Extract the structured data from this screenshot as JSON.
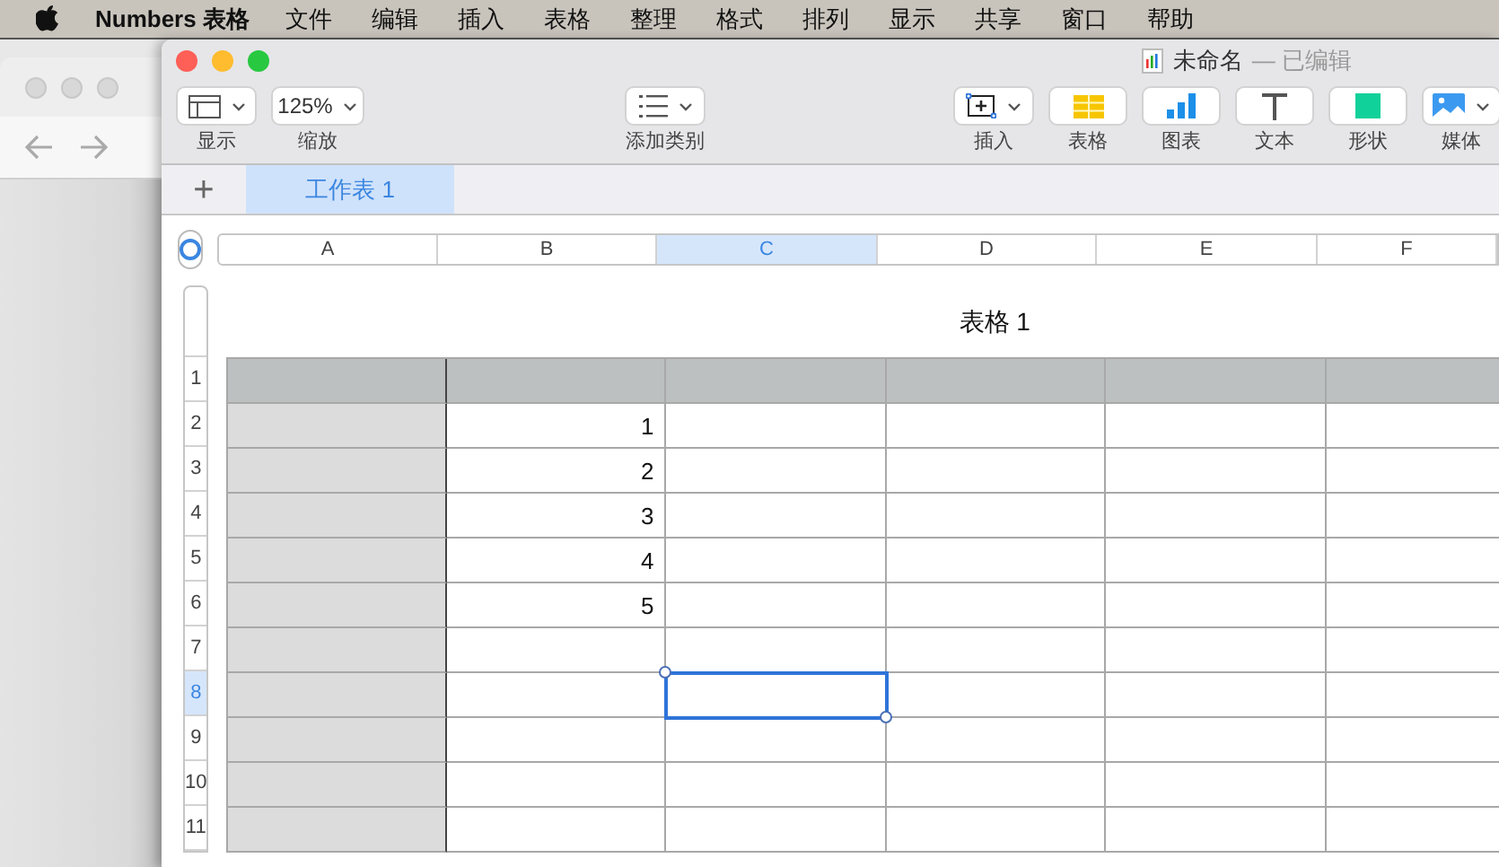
{
  "menu_bar": {
    "app": "Numbers 表格",
    "items": [
      "文件",
      "编辑",
      "插入",
      "表格",
      "整理",
      "格式",
      "排列",
      "显示",
      "共享",
      "窗口",
      "帮助"
    ]
  },
  "window": {
    "title": "未命名",
    "subtitle": "— 已编辑"
  },
  "toolbar": {
    "left": [
      {
        "kind": "view",
        "label": "显示"
      },
      {
        "kind": "zoom",
        "label": "缩放",
        "value": "125%"
      }
    ],
    "center": [
      {
        "kind": "category",
        "label": "添加类别"
      }
    ],
    "right": [
      {
        "kind": "insert",
        "label": "插入"
      },
      {
        "kind": "table",
        "label": "表格"
      },
      {
        "kind": "chart",
        "label": "图表"
      },
      {
        "kind": "text",
        "label": "文本"
      },
      {
        "kind": "shape",
        "label": "形状"
      },
      {
        "kind": "media",
        "label": "媒体"
      }
    ]
  },
  "sheet_tabs": {
    "add": "+",
    "tabs": [
      {
        "label": "工作表 1",
        "selected": true
      }
    ]
  },
  "table": {
    "title": "表格 1",
    "columns": [
      {
        "label": "A",
        "selected": false
      },
      {
        "label": "B",
        "selected": false
      },
      {
        "label": "C",
        "selected": true
      },
      {
        "label": "D",
        "selected": false
      },
      {
        "label": "E",
        "selected": false
      },
      {
        "label": "F",
        "selected": false
      }
    ],
    "rows": [
      {
        "label": "1",
        "selected": false,
        "cells": [
          {
            "text": "",
            "selected": false
          },
          {
            "text": "",
            "selected": false
          },
          {
            "text": "",
            "selected": false
          },
          {
            "text": "",
            "selected": false
          },
          {
            "text": "",
            "selected": false
          },
          {
            "text": "",
            "selected": false
          }
        ]
      },
      {
        "label": "2",
        "selected": false,
        "cells": [
          {
            "text": "",
            "selected": false
          },
          {
            "text": "1",
            "selected": false
          },
          {
            "text": "",
            "selected": false
          },
          {
            "text": "",
            "selected": false
          },
          {
            "text": "",
            "selected": false
          },
          {
            "text": "",
            "selected": false
          }
        ]
      },
      {
        "label": "3",
        "selected": false,
        "cells": [
          {
            "text": "",
            "selected": false
          },
          {
            "text": "2",
            "selected": false
          },
          {
            "text": "",
            "selected": false
          },
          {
            "text": "",
            "selected": false
          },
          {
            "text": "",
            "selected": false
          },
          {
            "text": "",
            "selected": false
          }
        ]
      },
      {
        "label": "4",
        "selected": false,
        "cells": [
          {
            "text": "",
            "selected": false
          },
          {
            "text": "3",
            "selected": false
          },
          {
            "text": "",
            "selected": false
          },
          {
            "text": "",
            "selected": false
          },
          {
            "text": "",
            "selected": false
          },
          {
            "text": "",
            "selected": false
          }
        ]
      },
      {
        "label": "5",
        "selected": false,
        "cells": [
          {
            "text": "",
            "selected": false
          },
          {
            "text": "4",
            "selected": false
          },
          {
            "text": "",
            "selected": false
          },
          {
            "text": "",
            "selected": false
          },
          {
            "text": "",
            "selected": false
          },
          {
            "text": "",
            "selected": false
          }
        ]
      },
      {
        "label": "6",
        "selected": false,
        "cells": [
          {
            "text": "",
            "selected": false
          },
          {
            "text": "5",
            "selected": false
          },
          {
            "text": "",
            "selected": false
          },
          {
            "text": "",
            "selected": false
          },
          {
            "text": "",
            "selected": false
          },
          {
            "text": "",
            "selected": false
          }
        ]
      },
      {
        "label": "7",
        "selected": false,
        "cells": [
          {
            "text": "",
            "selected": false
          },
          {
            "text": "",
            "selected": false
          },
          {
            "text": "",
            "selected": false
          },
          {
            "text": "",
            "selected": false
          },
          {
            "text": "",
            "selected": false
          },
          {
            "text": "",
            "selected": false
          }
        ]
      },
      {
        "label": "8",
        "selected": true,
        "cells": [
          {
            "text": "",
            "selected": false
          },
          {
            "text": "",
            "selected": false
          },
          {
            "text": "",
            "selected": true
          },
          {
            "text": "",
            "selected": false
          },
          {
            "text": "",
            "selected": false
          },
          {
            "text": "",
            "selected": false
          }
        ]
      },
      {
        "label": "9",
        "selected": false,
        "cells": [
          {
            "text": "",
            "selected": false
          },
          {
            "text": "",
            "selected": false
          },
          {
            "text": "",
            "selected": false
          },
          {
            "text": "",
            "selected": false
          },
          {
            "text": "",
            "selected": false
          },
          {
            "text": "",
            "selected": false
          }
        ]
      },
      {
        "label": "10",
        "selected": false,
        "cells": [
          {
            "text": "",
            "selected": false
          },
          {
            "text": "",
            "selected": false
          },
          {
            "text": "",
            "selected": false
          },
          {
            "text": "",
            "selected": false
          },
          {
            "text": "",
            "selected": false
          },
          {
            "text": "",
            "selected": false
          }
        ]
      },
      {
        "label": "11",
        "selected": false,
        "cells": [
          {
            "text": "",
            "selected": false
          },
          {
            "text": "",
            "selected": false
          },
          {
            "text": "",
            "selected": false
          },
          {
            "text": "",
            "selected": false
          },
          {
            "text": "",
            "selected": false
          },
          {
            "text": "",
            "selected": false
          }
        ]
      }
    ]
  }
}
